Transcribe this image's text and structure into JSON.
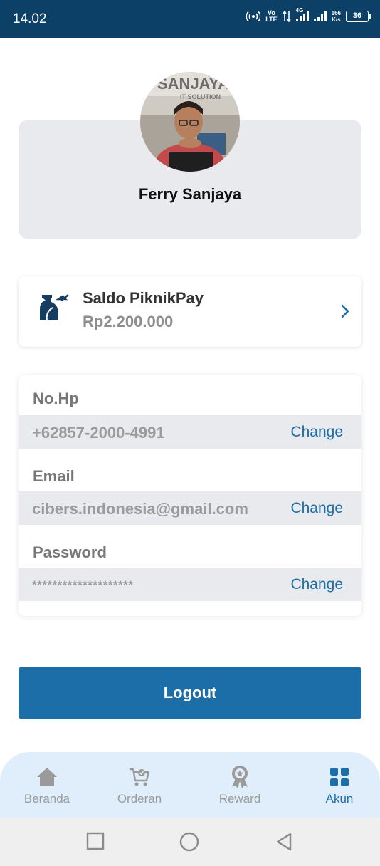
{
  "status_bar": {
    "time": "14.02",
    "volte_top": "Vo",
    "volte_bottom": "LTE",
    "network": "4G",
    "speed_top": "166",
    "speed_bottom": "K/s",
    "battery": "36"
  },
  "profile": {
    "name": "Ferry Sanjaya"
  },
  "saldo": {
    "title": "Saldo PiknikPay",
    "amount": "Rp2.200.000"
  },
  "account_fields": [
    {
      "label": "No.Hp",
      "value": "+62857-2000-4991",
      "action": "Change"
    },
    {
      "label": "Email",
      "value": "cibers.indonesia@gmail.com",
      "action": "Change"
    },
    {
      "label": "Password",
      "value": "********************",
      "action": "Change"
    }
  ],
  "logout": {
    "label": "Logout"
  },
  "bottom_nav": {
    "items": [
      {
        "label": "Beranda"
      },
      {
        "label": "Orderan"
      },
      {
        "label": "Reward"
      },
      {
        "label": "Akun"
      }
    ]
  },
  "colors": {
    "status_bar": "#0d4067",
    "accent": "#1c6ea8",
    "card_gray": "#e8eaed",
    "nav_bg": "#dfeefa"
  }
}
